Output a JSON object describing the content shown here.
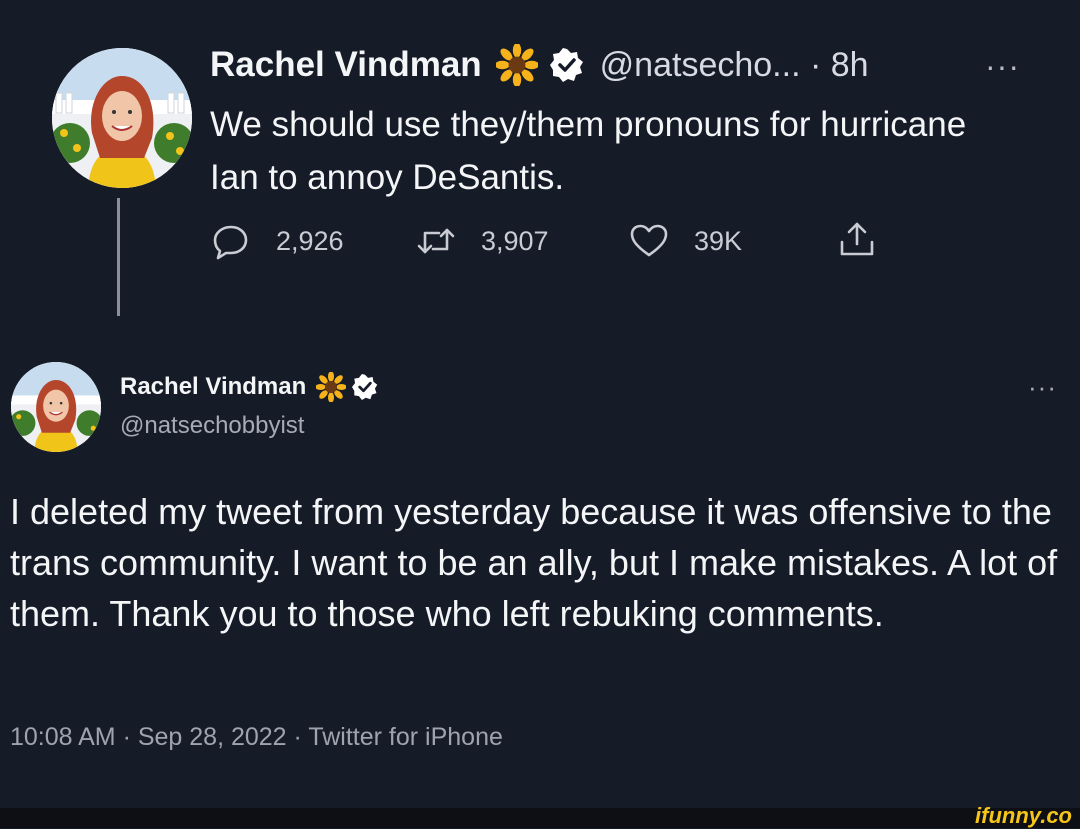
{
  "original_tweet": {
    "author_name": "Rachel Vindman",
    "handle": "@natsecho...",
    "separator": "·",
    "time": "8h",
    "more": "···",
    "text": "We should use they/them pronouns for hurricane Ian to annoy DeSantis.",
    "replies": "2,926",
    "retweets": "3,907",
    "likes": "39K",
    "icons": [
      "sunflower-icon",
      "verified-badge-icon",
      "reply-icon",
      "retweet-icon",
      "like-icon",
      "share-icon"
    ]
  },
  "followup_tweet": {
    "author_name": "Rachel Vindman",
    "handle": "@natsechobbyist",
    "more": "···",
    "text": "I deleted my tweet from yesterday because it was offensive to the trans community. I want to be an ally, but I make mistakes. A lot of them. Thank you to those who left rebuking comments.",
    "meta": "10:08 AM · Sep 28, 2022 · Twitter for iPhone"
  },
  "watermark": "ifunny.co",
  "colors": {
    "background": "#161b28",
    "text": "#f4f5f7",
    "secondary_text": "#9ea3ae",
    "verified_badge": "#ffffff",
    "watermark": "#f5c518"
  }
}
